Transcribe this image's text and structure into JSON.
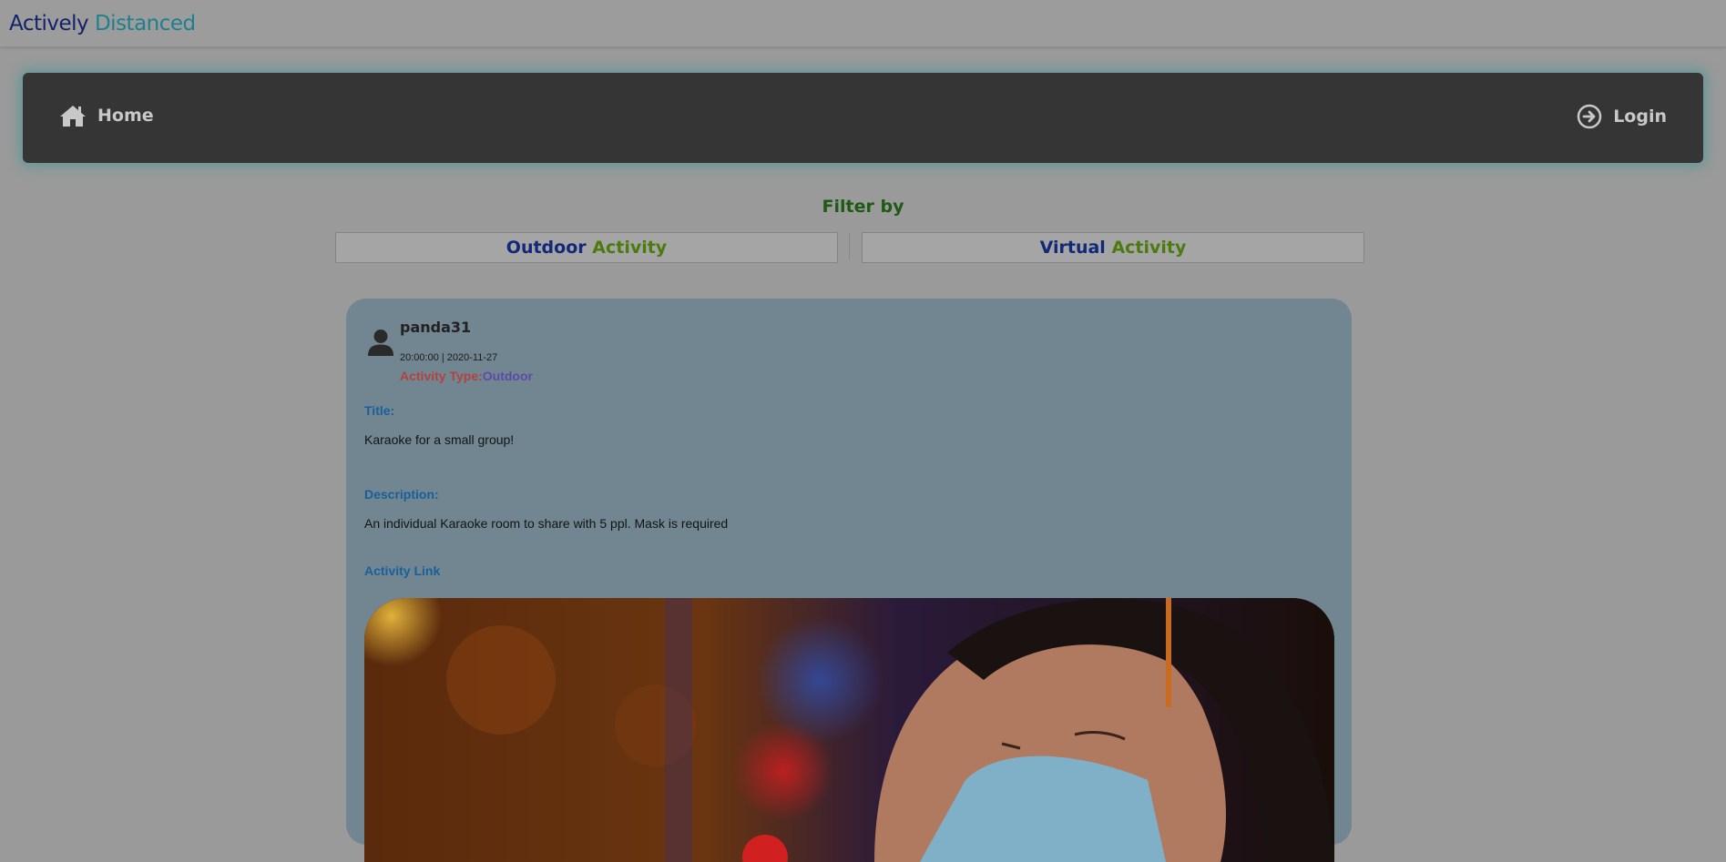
{
  "brand": {
    "word1": "Actively",
    "word2": "Distanced"
  },
  "nav": {
    "home_label": "Home",
    "login_label": "Login"
  },
  "filter": {
    "title": "Filter by",
    "outdoor": {
      "word1": "Outdoor",
      "word2": "Activity"
    },
    "virtual": {
      "word1": "Virtual",
      "word2": "Activity"
    }
  },
  "post": {
    "username": "panda31",
    "timestamp": "20:00:00 | 2020-11-27",
    "activity_type_label": "Activity Type:",
    "activity_type_value": "Outdoor",
    "title_label": "Title:",
    "title": "Karaoke for a small group!",
    "description_label": "Description:",
    "description": "An individual Karaoke room to share with 5 ppl. Mask is required",
    "link_label": "Activity Link"
  },
  "icons": {
    "home": "home-icon",
    "login": "circle-arrow-right-icon",
    "avatar": "user-icon"
  }
}
